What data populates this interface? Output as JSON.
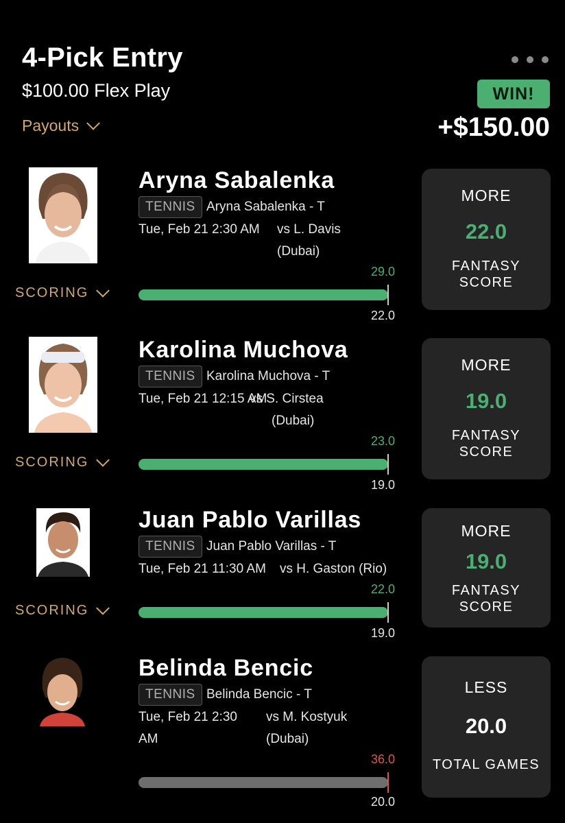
{
  "header": {
    "title": "4-Pick Entry",
    "subtitle": "$100.00 Flex Play",
    "payouts_label": "Payouts",
    "result_badge": "WIN!",
    "result_amount": "+$150.00"
  },
  "colors": {
    "win_green": "#4caf72",
    "loss_red": "#e0544b",
    "accent_gold": "#d5a86a",
    "card_bg": "#252525"
  },
  "picks": [
    {
      "name": "Aryna Sabalenka",
      "sport": "TENNIS",
      "market": "Aryna Sabalenka - T",
      "time": "Tue, Feb 21 2:30 AM",
      "opponent": "vs L. Davis",
      "location": "(Dubai)",
      "scoring_label": "SCORING",
      "actual": "29.0",
      "line": "22.0",
      "progress": 1.0,
      "direction": "MORE",
      "card_line": "22.0",
      "stat": [
        "FANTASY",
        "SCORE"
      ],
      "result": "hit",
      "photo_icon": "player-photo"
    },
    {
      "name": "Karolina Muchova",
      "sport": "TENNIS",
      "market": "Karolina Muchova - T",
      "time": "Tue, Feb 21 12:15 AM",
      "opponent": "vs S. Cirstea",
      "location": "(Dubai)",
      "scoring_label": "SCORING",
      "actual": "23.0",
      "line": "19.0",
      "progress": 1.0,
      "direction": "MORE",
      "card_line": "19.0",
      "stat": [
        "FANTASY",
        "SCORE"
      ],
      "result": "hit",
      "photo_icon": "player-photo"
    },
    {
      "name": "Juan Pablo Varillas",
      "sport": "TENNIS",
      "market": "Juan Pablo Varillas - T",
      "time": "Tue, Feb 21 11:30 AM",
      "opponent": "vs H. Gaston (Rio)",
      "location": "",
      "scoring_label": "SCORING",
      "actual": "22.0",
      "line": "19.0",
      "progress": 1.0,
      "direction": "MORE",
      "card_line": "19.0",
      "stat": [
        "FANTASY",
        "SCORE"
      ],
      "result": "hit",
      "photo_icon": "player-photo"
    },
    {
      "name": "Belinda Bencic",
      "sport": "TENNIS",
      "market": "Belinda Bencic - T",
      "time": "Tue, Feb 21 2:30",
      "time_line2": "AM",
      "opponent": "vs M. Kostyuk",
      "location": "(Dubai)",
      "scoring_label": "",
      "actual": "36.0",
      "line": "20.0",
      "progress": 1.0,
      "direction": "LESS",
      "card_line": "20.0",
      "stat": [
        "TOTAL GAMES"
      ],
      "result": "miss",
      "photo_icon": "player-photo"
    }
  ]
}
